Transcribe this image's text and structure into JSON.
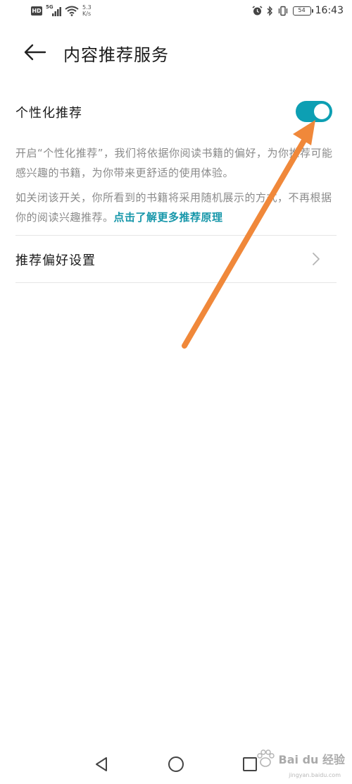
{
  "status_bar": {
    "hd": "HD",
    "signal_label": "5G",
    "net_speed_value": "5.3",
    "net_speed_unit": "K/s",
    "battery": "54",
    "time": "16:43"
  },
  "header": {
    "title": "内容推荐服务"
  },
  "personalized": {
    "label": "个性化推荐",
    "enabled": true,
    "desc_1": "开启“个性化推荐”，我们将依据你阅读书籍的偏好，为你推荐可能感兴趣的书籍，为你带来更舒适的使用体验。",
    "desc_2": "如关闭该开关，你所看到的书籍将采用随机展示的方式，不再根据你的阅读兴趣推荐。",
    "link": "点击了解更多推荐原理"
  },
  "preferences": {
    "label": "推荐偏好设置"
  },
  "watermark": {
    "text": "Bai du 经验",
    "sub": "jingyan.baidu.com"
  },
  "colors": {
    "accent": "#0d9fb3",
    "link": "#1797aa",
    "annotation_arrow": "#f0883a"
  }
}
